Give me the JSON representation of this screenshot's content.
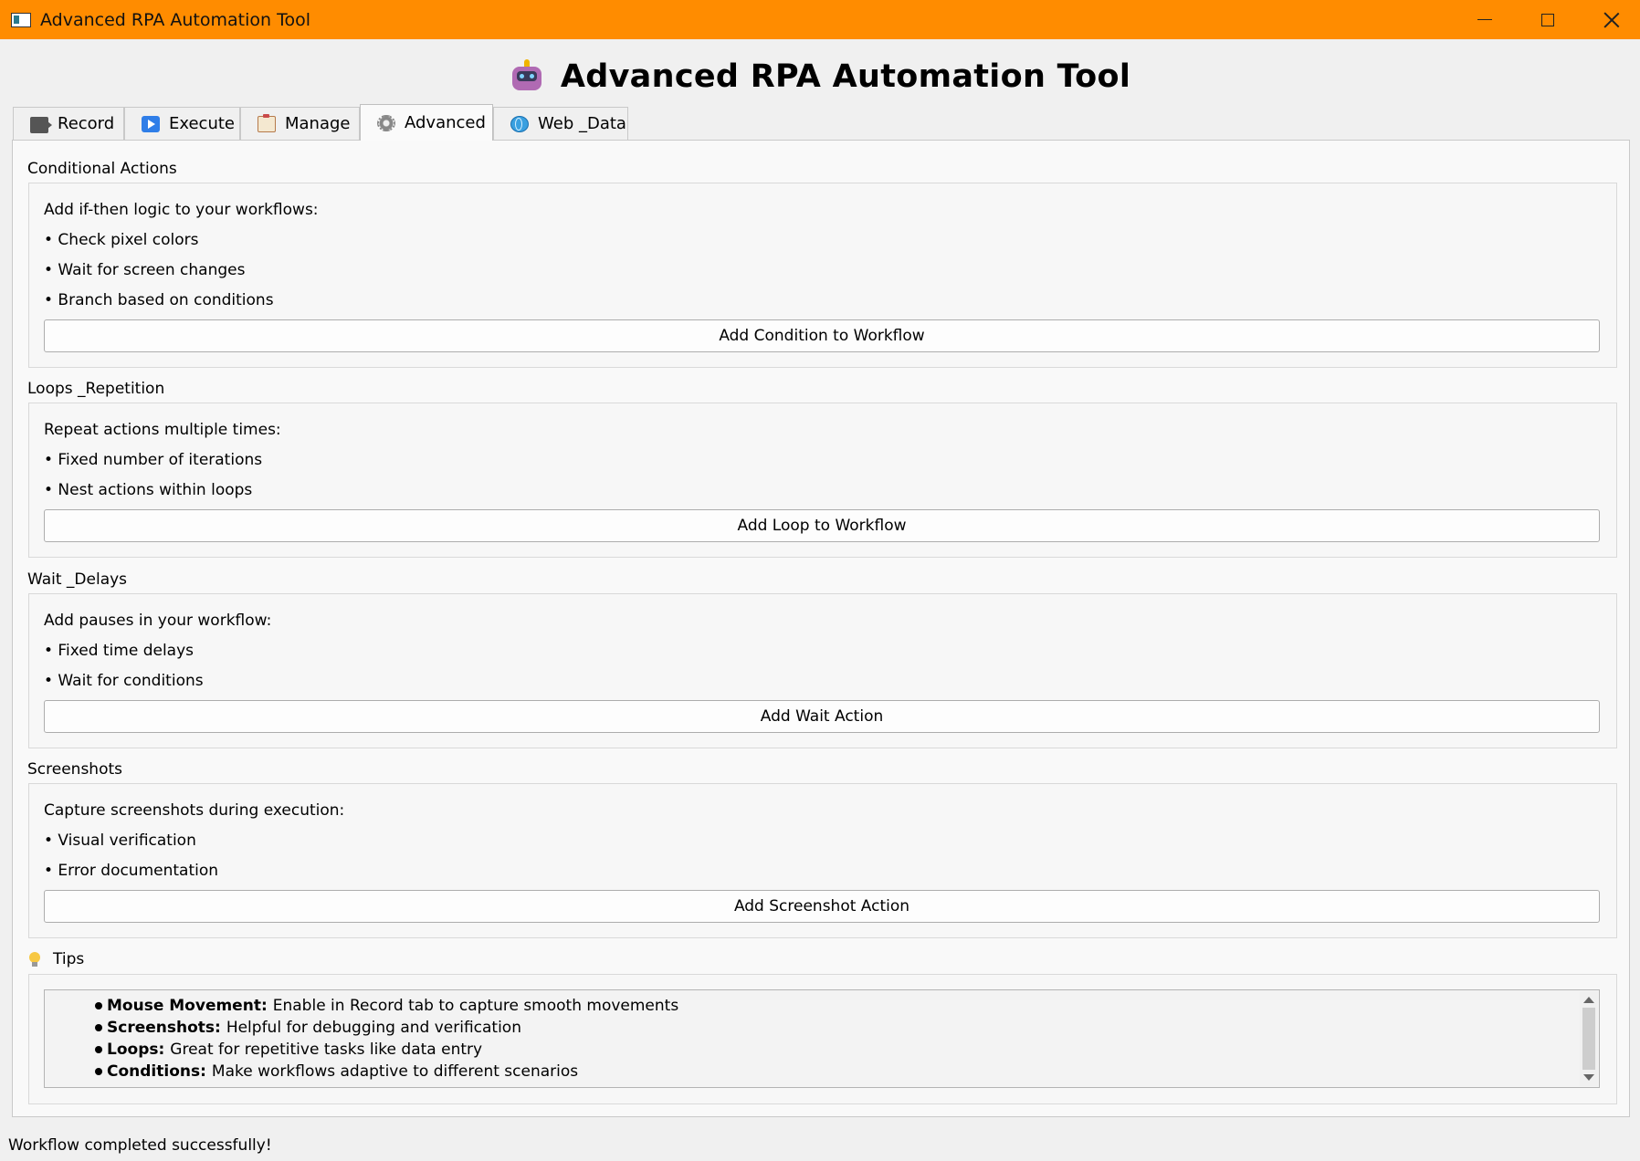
{
  "window": {
    "title": "Advanced RPA Automation Tool"
  },
  "header": {
    "title": "Advanced RPA Automation Tool",
    "icon": "robot-icon"
  },
  "tabs": [
    {
      "label": "Record",
      "icon": "video-camera-icon"
    },
    {
      "label": "Execute",
      "icon": "play-icon"
    },
    {
      "label": "Manage",
      "icon": "clipboard-icon"
    },
    {
      "label": "Advanced",
      "icon": "gear-icon",
      "active": true
    },
    {
      "label": "Web _Data",
      "icon": "globe-icon"
    }
  ],
  "sections": {
    "conditional": {
      "label": "Conditional Actions",
      "intro": "Add if-then logic to your workflows:",
      "items": [
        "• Check pixel colors",
        "• Wait for screen changes",
        "• Branch based on conditions"
      ],
      "button": "Add Condition to Workflow"
    },
    "loops": {
      "label": "Loops _Repetition",
      "intro": "Repeat actions multiple times:",
      "items": [
        "• Fixed number of iterations",
        "• Nest actions within loops"
      ],
      "button": "Add Loop to Workflow"
    },
    "wait": {
      "label": "Wait _Delays",
      "intro": "Add pauses in your workflow:",
      "items": [
        "• Fixed time delays",
        "• Wait for conditions"
      ],
      "button": "Add Wait Action"
    },
    "screenshots": {
      "label": "Screenshots",
      "intro": "Capture screenshots during execution:",
      "items": [
        "• Visual verification",
        "• Error documentation"
      ],
      "button": "Add Screenshot Action"
    }
  },
  "tips": {
    "label": "Tips",
    "items": [
      {
        "title": "Mouse Movement:",
        "text": "Enable in Record tab to capture smooth movements"
      },
      {
        "title": "Screenshots:",
        "text": "Helpful for debugging and verification"
      },
      {
        "title": "Loops:",
        "text": "Great for repetitive tasks like data entry"
      },
      {
        "title": "Conditions:",
        "text": "Make workflows adaptive to different scenarios"
      }
    ]
  },
  "status": {
    "text": "Workflow completed successfully!"
  },
  "colors": {
    "titlebar": "#ff8c00"
  }
}
